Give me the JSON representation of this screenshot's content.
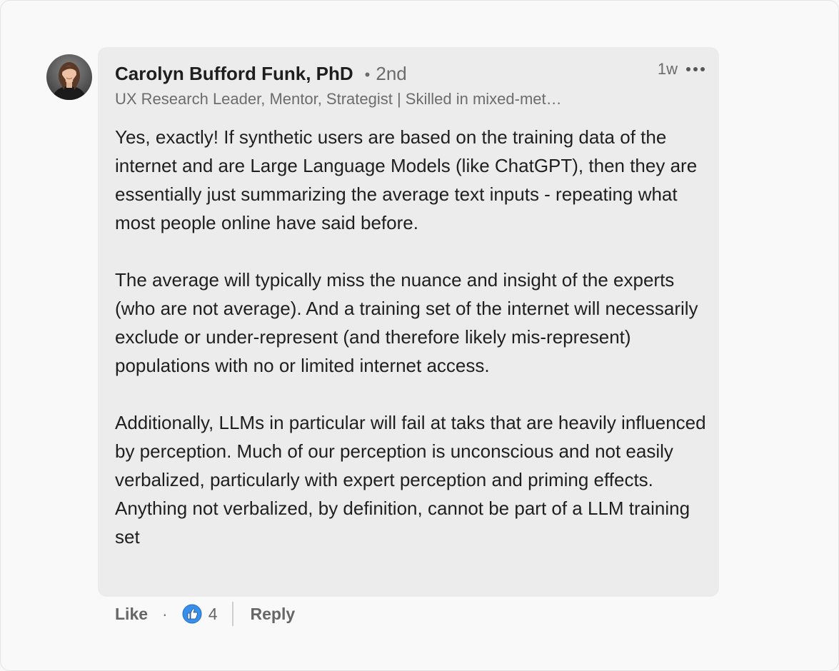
{
  "comment": {
    "author": {
      "name": "Carolyn Bufford Funk, PhD",
      "separator": "•",
      "degree": "2nd",
      "headline": "UX Research Leader, Mentor, Strategist | Skilled in mixed-met…",
      "avatar_icon": "profile-photo"
    },
    "timestamp": "1w",
    "more_icon": "ellipsis-icon",
    "paragraphs": [
      "Yes, exactly! If synthetic users are based on the training data of the internet and are Large Language Models (like ChatGPT), then they are essentially just summarizing the average text inputs - repeating what most people online have said before.",
      "The average will typically miss the nuance and insight of the experts (who are not average). And a training set of the internet will necessarily exclude or under-represent (and therefore likely mis-represent) populations with no or limited internet access.",
      "Additionally, LLMs in particular will fail at taks that are heavily influenced by perception. Much of our perception is unconscious and not easily verbalized, particularly with expert perception and priming effects. Anything not verbalized, by definition, cannot be part of a LLM training set"
    ]
  },
  "actions": {
    "like_label": "Like",
    "dot": "·",
    "reaction_icon": "like-thumb-icon",
    "reaction_color": "#378fe9",
    "reaction_count": "4",
    "reply_label": "Reply"
  }
}
